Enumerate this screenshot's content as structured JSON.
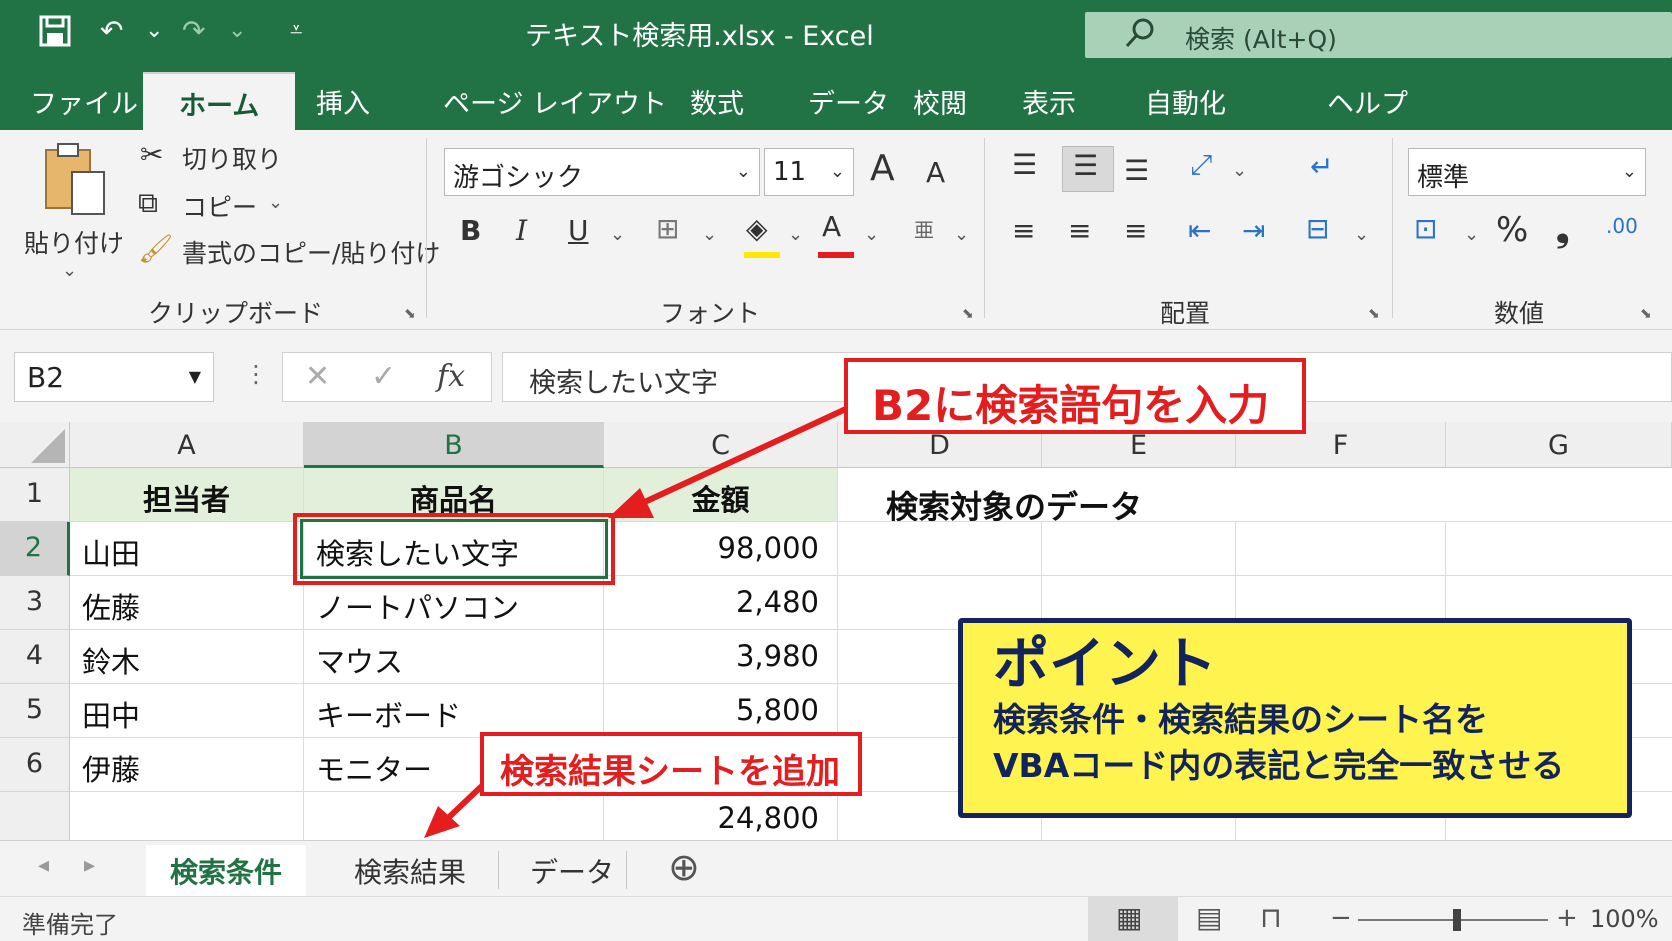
{
  "titlebar": {
    "doc_title": "テキスト検索用.xlsx  -  Excel",
    "search_placeholder": "検索 (Alt+Q)",
    "save_icon": "💾",
    "undo_icon": "↶",
    "redo_icon": "↷",
    "dropdown_icon": "⌄",
    "customize_icon": "⩡",
    "search_icon": "⚲"
  },
  "tabs": {
    "file": "ファイル",
    "home": "ホーム",
    "insert": "挿入",
    "page_layout": "ページ レイアウト",
    "formulas": "数式",
    "data": "データ",
    "review": "校閲",
    "view": "表示",
    "automate": "自動化",
    "help": "ヘルプ"
  },
  "ribbon": {
    "clipboard": {
      "paste": "貼り付け",
      "cut": "切り取り",
      "copy": "コピー",
      "format_painter": "書式のコピー/貼り付け",
      "group_label": "クリップボード"
    },
    "font": {
      "font_name": "游ゴシック",
      "font_size": "11",
      "grow": "A",
      "shrink": "A",
      "bold": "B",
      "italic": "I",
      "underline": "U",
      "font_color_letter": "A",
      "group_label": "フォント"
    },
    "alignment": {
      "group_label": "配置"
    },
    "number": {
      "format": "標準",
      "percent": "%",
      "comma": "❟",
      "group_label": "数値"
    }
  },
  "formula_bar": {
    "name_box": "B2",
    "cancel": "✕",
    "enter": "✓",
    "fx": "fx",
    "content": "検索したい文字"
  },
  "grid": {
    "columns": [
      "A",
      "B",
      "C",
      "D",
      "E",
      "F",
      "G"
    ],
    "rows": [
      "1",
      "2",
      "3",
      "4",
      "5",
      "6",
      ""
    ],
    "headers": [
      "担当者",
      "商品名",
      "金額"
    ],
    "data": [
      [
        "山田",
        "検索したい文字",
        "98,000"
      ],
      [
        "佐藤",
        "ノートパソコン",
        "2,480"
      ],
      [
        "鈴木",
        "マウス",
        "3,980"
      ],
      [
        "田中",
        "キーボード",
        "5,800"
      ],
      [
        "伊藤",
        "モニター",
        ""
      ]
    ],
    "total": "24,800",
    "side_title": "検索対象のデータ"
  },
  "sheets": {
    "tabs": [
      "検索条件",
      "検索結果",
      "データ"
    ],
    "active": "検索条件",
    "add_icon": "⊕",
    "prev_icon": "◂",
    "next_icon": "▸"
  },
  "status": {
    "ready": "準備完了",
    "zoom": "100%",
    "minus": "−",
    "plus": "+"
  },
  "annotations": {
    "callout_b2": "B2に検索語句を入力",
    "callout_sheet": "検索結果シートを追加",
    "point_title": "ポイント",
    "point_line1": "検索条件・検索結果のシート名を",
    "point_line2": "VBAコード内の表記と完全一致させる",
    "accent_red": "#e41e1e",
    "point_bg": "#fff34f",
    "point_border": "#12245b",
    "excel_green": "#217346"
  }
}
